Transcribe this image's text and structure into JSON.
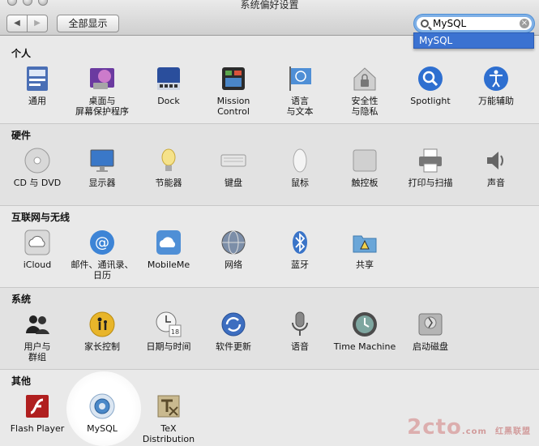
{
  "window": {
    "title": "系统偏好设置"
  },
  "toolbar": {
    "back_glyph": "◀",
    "forward_glyph": "▶",
    "show_all_label": "全部显示"
  },
  "search": {
    "value": "MySQL",
    "clear_glyph": "×"
  },
  "dropdown": {
    "result": "MySQL"
  },
  "sections": {
    "personal": {
      "title": "个人",
      "items": [
        "通用",
        "桌面与\n屏幕保护程序",
        "Dock",
        "Mission\nControl",
        "语言\n与文本",
        "安全性\n与隐私",
        "Spotlight",
        "万能辅助"
      ]
    },
    "hardware": {
      "title": "硬件",
      "items": [
        "CD 与 DVD",
        "显示器",
        "节能器",
        "键盘",
        "鼠标",
        "触控板",
        "打印与扫描",
        "声音"
      ]
    },
    "internet": {
      "title": "互联网与无线",
      "items": [
        "iCloud",
        "邮件、通讯录、\n日历",
        "MobileMe",
        "网络",
        "蓝牙",
        "共享"
      ]
    },
    "system": {
      "title": "系统",
      "items": [
        "用户与\n群组",
        "家长控制",
        "日期与时间",
        "软件更新",
        "语音",
        "Time Machine",
        "启动磁盘"
      ]
    },
    "other": {
      "title": "其他",
      "items": [
        "Flash Player",
        "MySQL",
        "TeX\nDistribution"
      ]
    }
  },
  "watermark": {
    "text": "2cto",
    "suffix": ".com",
    "subtitle": "红黑联盟"
  },
  "colors": {
    "accent": "#3b72d1",
    "section_alt": "#e2e2e2"
  }
}
